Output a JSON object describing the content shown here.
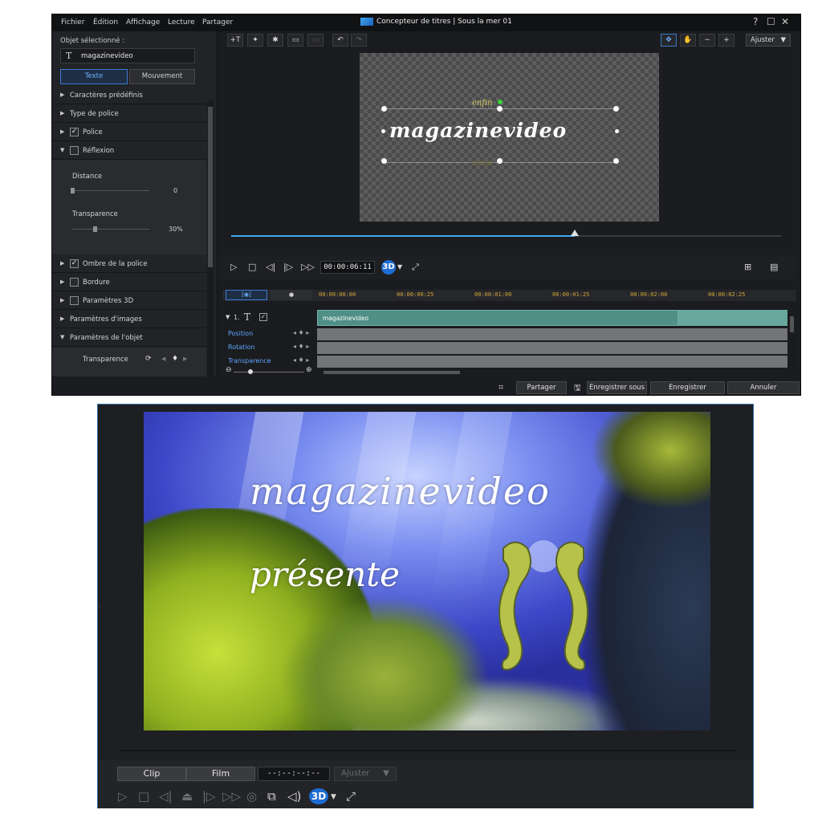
{
  "designer": {
    "menu": [
      "Fichier",
      "Édition",
      "Affichage",
      "Lecture",
      "Partager"
    ],
    "title": "Concepteur de titres | Sous la mer 01",
    "window_controls": {
      "help": "?",
      "maximize": "☐",
      "close": "✕"
    },
    "left_panel": {
      "selected_label": "Objet sélectionné :",
      "selected_value": "magazinevideo",
      "tabs": {
        "text": "Texte",
        "motion": "Mouvement"
      },
      "sections": [
        {
          "label": "Caractères prédéfinis"
        },
        {
          "label": "Type de police"
        },
        {
          "label": "Police",
          "checked": true
        },
        {
          "label": "Réflexion",
          "checked": false
        },
        {
          "label": "Ombre de la police",
          "checked": true
        },
        {
          "label": "Bordure",
          "checked": false
        },
        {
          "label": "Paramètres 3D",
          "checked": false
        },
        {
          "label": "Paramètres d'images"
        },
        {
          "label": "Paramètres de l'objet"
        }
      ],
      "reflection": {
        "distance_label": "Distance",
        "distance_value": "0",
        "transparency_label": "Transparence",
        "transparency_value": "30%"
      },
      "object_transparency_label": "Transparence"
    },
    "toolbar": {
      "fit": "Ajuster"
    },
    "canvas": {
      "top_text": "enfin",
      "main_text": "magazinevideo",
      "reflection_text": "enfin"
    },
    "playback": {
      "timecode": "00:00:06:11",
      "position": 0.625
    },
    "timeline": {
      "ticks": [
        "00:00:00:00",
        "00:00:00:25",
        "00:00:01:00",
        "00:00:01:25",
        "00:00:02:00",
        "00:00:02:25"
      ],
      "track_label": "1.",
      "clip_label": "magazinevideo",
      "rows": [
        "Position",
        "Rotation",
        "Transparence"
      ]
    },
    "buttons": {
      "share": "Partager",
      "save_as": "Enregistrer sous",
      "save": "Enregistrer",
      "cancel": "Annuler"
    },
    "colors": {
      "accent": "#3fa9f5",
      "link": "#5ea6ff",
      "timecode": "#d7a93a"
    }
  },
  "player": {
    "overlay_title": "magazinevideo",
    "overlay_subtitle": "présente",
    "tabs": {
      "clip": "Clip",
      "film": "Film"
    },
    "time": "--:--:--:--",
    "fit": "Ajuster",
    "icons": [
      "play-icon",
      "stop-icon",
      "previous-frame-icon",
      "split-icon",
      "next-frame-icon",
      "fast-forward-icon",
      "snapshot-icon",
      "external-display-icon",
      "volume-icon",
      "3d-icon",
      "fullscreen-icon"
    ]
  }
}
